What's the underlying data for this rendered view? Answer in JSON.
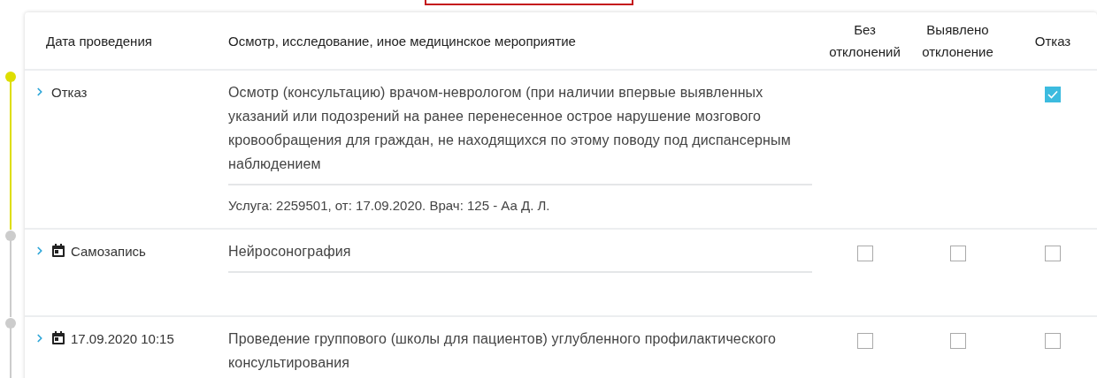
{
  "columns": [
    "Дата проведения",
    "Осмотр, исследование, иное медицинское мероприятие",
    "Без отклонений",
    "Выявлено отклонение",
    "Отказ"
  ],
  "rows": [
    {
      "kind": "status",
      "date": "Отказ",
      "color": "#dede00",
      "description": "Осмотр (консультацию) врачом-неврологом (при наличии впервые выявленных указаний или подозрений на ранее перенесенное острое нарушение мозгового кровообращения для граждан, не находящихся по этому поводу под диспансерным наблюдением",
      "service": "Услуга: 2259501, от: 17.09.2020. Врач: 125 - Аа Д. Л.",
      "checks": [
        {
          "kind": "none"
        },
        {
          "kind": "none"
        },
        {
          "kind": "checkbox",
          "checked": true
        }
      ]
    },
    {
      "kind": "appointment",
      "date": "Самозапись",
      "color": "#cccccc",
      "description": "Нейросонография",
      "checks": [
        {
          "kind": "checkbox",
          "checked": false
        },
        {
          "kind": "checkbox",
          "checked": false
        },
        {
          "kind": "checkbox",
          "checked": false
        }
      ]
    },
    {
      "kind": "appointment",
      "date": "17.09.2020 10:15",
      "color": "#cccccc",
      "description": "Проведение группового (школы для пациентов) углубленного профилактического консультирования",
      "checks": [
        {
          "kind": "checkbox",
          "checked": false
        },
        {
          "kind": "checkbox",
          "checked": false
        },
        {
          "kind": "checkbox",
          "checked": false
        }
      ]
    }
  ]
}
